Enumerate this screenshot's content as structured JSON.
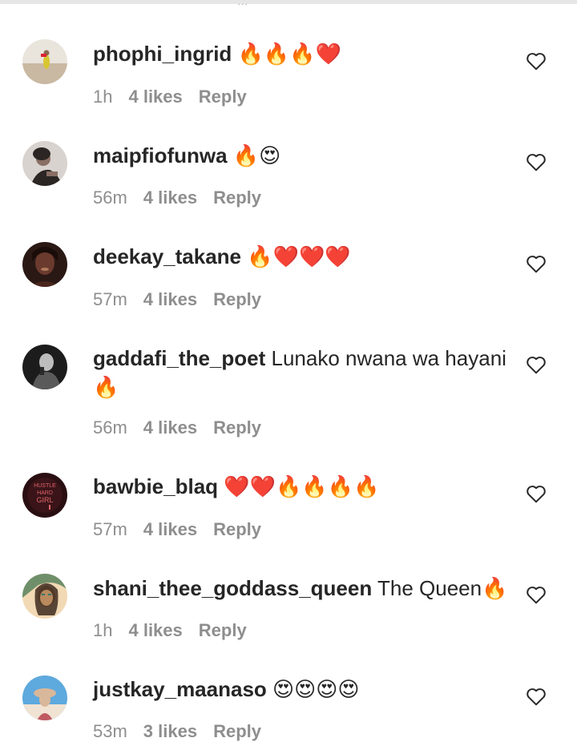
{
  "header": {
    "sliver_text": "..."
  },
  "comments": [
    {
      "username": "phophi_ingrid",
      "text": "🔥🔥🔥❤️",
      "time": "1h",
      "likes": "4 likes",
      "reply": "Reply",
      "avatar_colors": [
        "#e9e4dc",
        "#c9b8a2",
        "#d8c631"
      ]
    },
    {
      "username": "maipfiofunwa",
      "text": "🔥😍",
      "time": "56m",
      "likes": "4 likes",
      "reply": "Reply",
      "avatar_colors": [
        "#d9d3cf",
        "#8a6f64",
        "#2b2624"
      ]
    },
    {
      "username": "deekay_takane",
      "text": "🔥❤️❤️❤️",
      "time": "57m",
      "likes": "4 likes",
      "reply": "Reply",
      "avatar_colors": [
        "#2a1814",
        "#6b3a2e",
        "#b07a5c"
      ]
    },
    {
      "username": "gaddafi_the_poet",
      "text": "Lunako nwana wa hayani 🔥",
      "time": "56m",
      "likes": "4 likes",
      "reply": "Reply",
      "avatar_colors": [
        "#1c1c1c",
        "#5a5a5a",
        "#bdbdbd"
      ]
    },
    {
      "username": "bawbie_blaq",
      "text": "❤️❤️🔥🔥🔥🔥",
      "time": "57m",
      "likes": "4 likes",
      "reply": "Reply",
      "avatar_colors": [
        "#2a0f12",
        "#7a1c22",
        "#e0646c"
      ],
      "avatar_sign": [
        "HUSTLE",
        "HARD",
        "GIRL"
      ]
    },
    {
      "username": "shani_thee_goddass_queen",
      "text": "The Queen🔥",
      "time": "1h",
      "likes": "4 likes",
      "reply": "Reply",
      "avatar_colors": [
        "#3e2a1f",
        "#b88a5e",
        "#f2d9b5"
      ]
    },
    {
      "username": "justkay_maanaso",
      "text": "😍😍😍😍",
      "time": "53m",
      "likes": "3 likes",
      "reply": "Reply",
      "avatar_colors": [
        "#5ea9dd",
        "#d9b79a",
        "#f1e3d3"
      ]
    }
  ],
  "colors": {
    "text": "#262626",
    "meta": "#8e8e8e"
  }
}
